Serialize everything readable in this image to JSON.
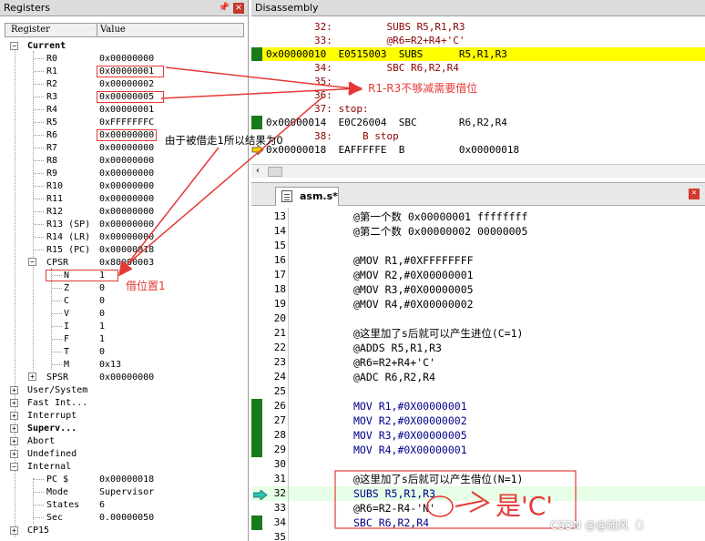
{
  "registers": {
    "title": "Registers",
    "col_register": "Register",
    "col_value": "Value",
    "current_label": "Current",
    "rows": [
      {
        "name": "R0",
        "value": "0x00000000"
      },
      {
        "name": "R1",
        "value": "0x00000001"
      },
      {
        "name": "R2",
        "value": "0x00000002"
      },
      {
        "name": "R3",
        "value": "0x00000005"
      },
      {
        "name": "R4",
        "value": "0x00000001"
      },
      {
        "name": "R5",
        "value": "0xFFFFFFFC"
      },
      {
        "name": "R6",
        "value": "0x00000000"
      },
      {
        "name": "R7",
        "value": "0x00000000"
      },
      {
        "name": "R8",
        "value": "0x00000000"
      },
      {
        "name": "R9",
        "value": "0x00000000"
      },
      {
        "name": "R10",
        "value": "0x00000000"
      },
      {
        "name": "R11",
        "value": "0x00000000"
      },
      {
        "name": "R12",
        "value": "0x00000000"
      },
      {
        "name": "R13 (SP)",
        "value": "0x00000000"
      },
      {
        "name": "R14 (LR)",
        "value": "0x00000000"
      },
      {
        "name": "R15 (PC)",
        "value": "0x00000018"
      }
    ],
    "cpsr": {
      "name": "CPSR",
      "value": "0x80000003"
    },
    "flags": [
      {
        "name": "N",
        "value": "1"
      },
      {
        "name": "Z",
        "value": "0"
      },
      {
        "name": "C",
        "value": "0"
      },
      {
        "name": "V",
        "value": "0"
      },
      {
        "name": "I",
        "value": "1"
      },
      {
        "name": "F",
        "value": "1"
      },
      {
        "name": "T",
        "value": "0"
      },
      {
        "name": "M",
        "value": "0x13"
      }
    ],
    "spsr": {
      "name": "SPSR",
      "value": "0x00000000"
    },
    "groups": [
      "User/System",
      "Fast Int...",
      "Interrupt",
      "Superv...",
      "Abort",
      "Undefined",
      "Internal"
    ],
    "internal": [
      {
        "name": "PC  $",
        "value": "0x00000018"
      },
      {
        "name": "Mode",
        "value": "Supervisor"
      },
      {
        "name": "States",
        "value": "6"
      },
      {
        "name": "Sec",
        "value": "0.00000050"
      }
    ],
    "cp15": "CP15"
  },
  "disassembly": {
    "title": "Disassembly",
    "lines": [
      {
        "text": "        32:         SUBS R5,R1,R3",
        "hl": false,
        "marker": ""
      },
      {
        "text": "        33:         @R6=R2+R4+'C'",
        "hl": false,
        "marker": ""
      },
      {
        "text": "0x00000010  E0515003  SUBS      R5,R1,R3",
        "hl": true,
        "marker": "green"
      },
      {
        "text": "        34:         SBC R6,R2,R4",
        "hl": false,
        "marker": ""
      },
      {
        "text": "        35:",
        "hl": false,
        "marker": ""
      },
      {
        "text": "        36:",
        "hl": false,
        "marker": ""
      },
      {
        "text": "        37: stop:",
        "hl": false,
        "marker": ""
      },
      {
        "text": "0x00000014  E0C26004  SBC       R6,R2,R4",
        "hl": false,
        "marker": "green"
      },
      {
        "text": "        38:     B stop",
        "hl": false,
        "marker": ""
      },
      {
        "text": "0x00000018  EAFFFFFE  B         0x00000018",
        "hl": false,
        "marker": "arrow"
      }
    ]
  },
  "editor": {
    "tab_label": "asm.s*",
    "lines": [
      {
        "n": "13",
        "text": "@第一个数 0x00000001 ffffffff",
        "style": "cmt",
        "g": false
      },
      {
        "n": "14",
        "text": "@第二个数 0x00000002 00000005",
        "style": "cmt",
        "g": false
      },
      {
        "n": "15",
        "text": "",
        "style": "cmt",
        "g": false
      },
      {
        "n": "16",
        "text": "@MOV R1,#0XFFFFFFFF",
        "style": "cmt",
        "g": false
      },
      {
        "n": "17",
        "text": "@MOV R2,#0X00000001",
        "style": "cmt",
        "g": false
      },
      {
        "n": "18",
        "text": "@MOV R3,#0X00000005",
        "style": "cmt",
        "g": false
      },
      {
        "n": "19",
        "text": "@MOV R4,#0X00000002",
        "style": "cmt",
        "g": false
      },
      {
        "n": "20",
        "text": "",
        "style": "cmt",
        "g": false
      },
      {
        "n": "21",
        "text": "@这里加了s后就可以产生进位(C=1)",
        "style": "cmt",
        "g": false
      },
      {
        "n": "22",
        "text": "@ADDS R5,R1,R3",
        "style": "cmt",
        "g": false
      },
      {
        "n": "23",
        "text": "@R6=R2+R4+'C'",
        "style": "cmt",
        "g": false
      },
      {
        "n": "24",
        "text": "@ADC R6,R2,R4",
        "style": "cmt",
        "g": false
      },
      {
        "n": "25",
        "text": "",
        "style": "cmt",
        "g": false
      },
      {
        "n": "26",
        "text": "MOV R1,#0X00000001",
        "style": "code",
        "g": true
      },
      {
        "n": "27",
        "text": "MOV R2,#0X00000002",
        "style": "code",
        "g": true
      },
      {
        "n": "28",
        "text": "MOV R3,#0X00000005",
        "style": "code",
        "g": true
      },
      {
        "n": "29",
        "text": "MOV R4,#0X00000001",
        "style": "code",
        "g": true
      },
      {
        "n": "30",
        "text": "",
        "style": "cmt",
        "g": false
      },
      {
        "n": "31",
        "text": "@这里加了s后就可以产生借位(N=1)",
        "style": "cmt",
        "g": false
      },
      {
        "n": "32",
        "text": "SUBS R5,R1,R3",
        "style": "code",
        "g": false,
        "cur": true
      },
      {
        "n": "33",
        "text": "@R6=R2-R4-'N'",
        "style": "cmt",
        "g": false
      },
      {
        "n": "34",
        "text": "SBC R6,R2,R4",
        "style": "code",
        "g": true
      },
      {
        "n": "35",
        "text": "",
        "style": "cmt",
        "g": false
      }
    ]
  },
  "annotations": {
    "r1r3": "R1-R3不够减需要借位",
    "r6": "由于被借走1所以结果为0",
    "borrow": "借位置1",
    "is_c": "是'C'",
    "watermark": "CSDN @@随风（）"
  },
  "colors": {
    "red": "#e53935",
    "green": "#1a7a1a",
    "highlight": "#ffff00",
    "blue": "#00008b"
  }
}
